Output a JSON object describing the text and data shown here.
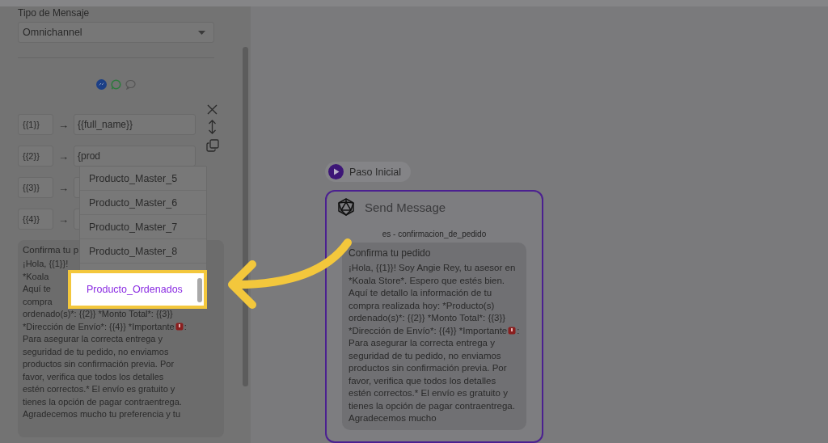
{
  "message_type": {
    "label": "Tipo de Mensaje",
    "value": "Omnichannel"
  },
  "mappings": [
    {
      "key": "{{1}}",
      "arrow": "→",
      "value": "{{full_name}}"
    },
    {
      "key": "{{2}}",
      "arrow": "→",
      "value": "{prod"
    },
    {
      "key": "{{3}}",
      "arrow": "→"
    },
    {
      "key": "{{4}}",
      "arrow": "→"
    }
  ],
  "suggestions": [
    {
      "label": "Producto_Master_5",
      "selected": false
    },
    {
      "label": "Producto_Master_6",
      "selected": false
    },
    {
      "label": "Producto_Master_7",
      "selected": false
    },
    {
      "label": "Producto_Master_8",
      "selected": false
    },
    {
      "label": "Producto_Ordenados",
      "selected": true
    }
  ],
  "preview": {
    "title": "Confirma tu p",
    "lines": [
      {
        "kind": "text",
        "text": "¡Hola, {{1}}!"
      },
      {
        "kind": "text",
        "text": "*Koala"
      },
      {
        "kind": "text",
        "text": "Aquí te"
      },
      {
        "kind": "text",
        "text": "compra"
      },
      {
        "kind": "text",
        "text": "ordenado(s)*: {{2}} *Monto Total*: {{3}}"
      },
      {
        "kind": "alert",
        "before": "*Dirección de Envío*: {{4}} *Importante",
        "after": ":"
      },
      {
        "kind": "text",
        "text": "Para asegurar la correcta entrega y"
      },
      {
        "kind": "text",
        "text": "seguridad de tu pedido, no enviamos"
      },
      {
        "kind": "text",
        "text": "productos sin confirmación previa. Por"
      },
      {
        "kind": "text",
        "text": "favor, verifica que todos los detalles"
      },
      {
        "kind": "text",
        "text": "estén correctos.* El envío es gratuito y"
      },
      {
        "kind": "text",
        "text": "tienes la opción de pagar contraentrega."
      },
      {
        "kind": "text",
        "text": "Agradecemos mucho tu preferencia y tu"
      }
    ]
  },
  "canvas": {
    "start_label": "Paso Inicial",
    "node": {
      "title": "Send Message",
      "template": "es - confirmacion_de_pedido",
      "message_title": "Confirma tu pedido",
      "body_before": "¡Hola, {{1}}! Soy Angie Rey, tu asesor en *Koala Store*. Espero que estés bien. Aquí te detallo la información de tu compra realizada hoy: *Producto(s) ordenado(s)*: {{2}} *Monto Total*: {{3}} *Dirección de Envío*: {{4}} *Importante",
      "body_after": ": Para asegurar la correcta entrega y seguridad de tu pedido, no enviamos productos sin confirmación previa. Por favor, verifica que todos los detalles estén correctos.* El envío es gratuito y tienes la opción de pagar contraentrega. Agradecemos mucho"
    }
  }
}
